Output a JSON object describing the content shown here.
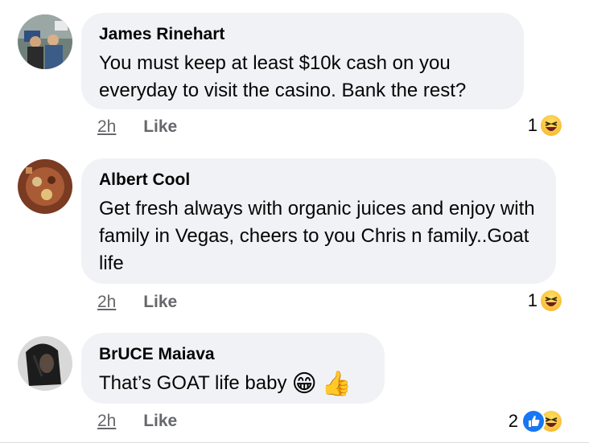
{
  "comments": [
    {
      "name": "James Rinehart",
      "text": "You must keep at least $10k cash on you everyday to visit the casino. Bank the rest?",
      "time": "2h",
      "like": "Like",
      "reaction_count": "1",
      "reactions": [
        "haha-icon"
      ]
    },
    {
      "name": "Albert Cool",
      "text": "Get fresh always with organic juices and enjoy with family in Vegas, cheers to you Chris n family..Goat life",
      "time": "2h",
      "like": "Like",
      "reaction_count": "1",
      "reactions": [
        "haha-icon"
      ]
    },
    {
      "name": "BrUCE Maiava",
      "text": "That’s GOAT life baby",
      "time": "2h",
      "like": "Like",
      "reaction_count": "2",
      "reactions": [
        "like-icon",
        "haha-icon"
      ]
    }
  ],
  "colors": {
    "bubble": "#f0f2f5",
    "meta": "#65676b",
    "like_blue": "#1877f2"
  }
}
